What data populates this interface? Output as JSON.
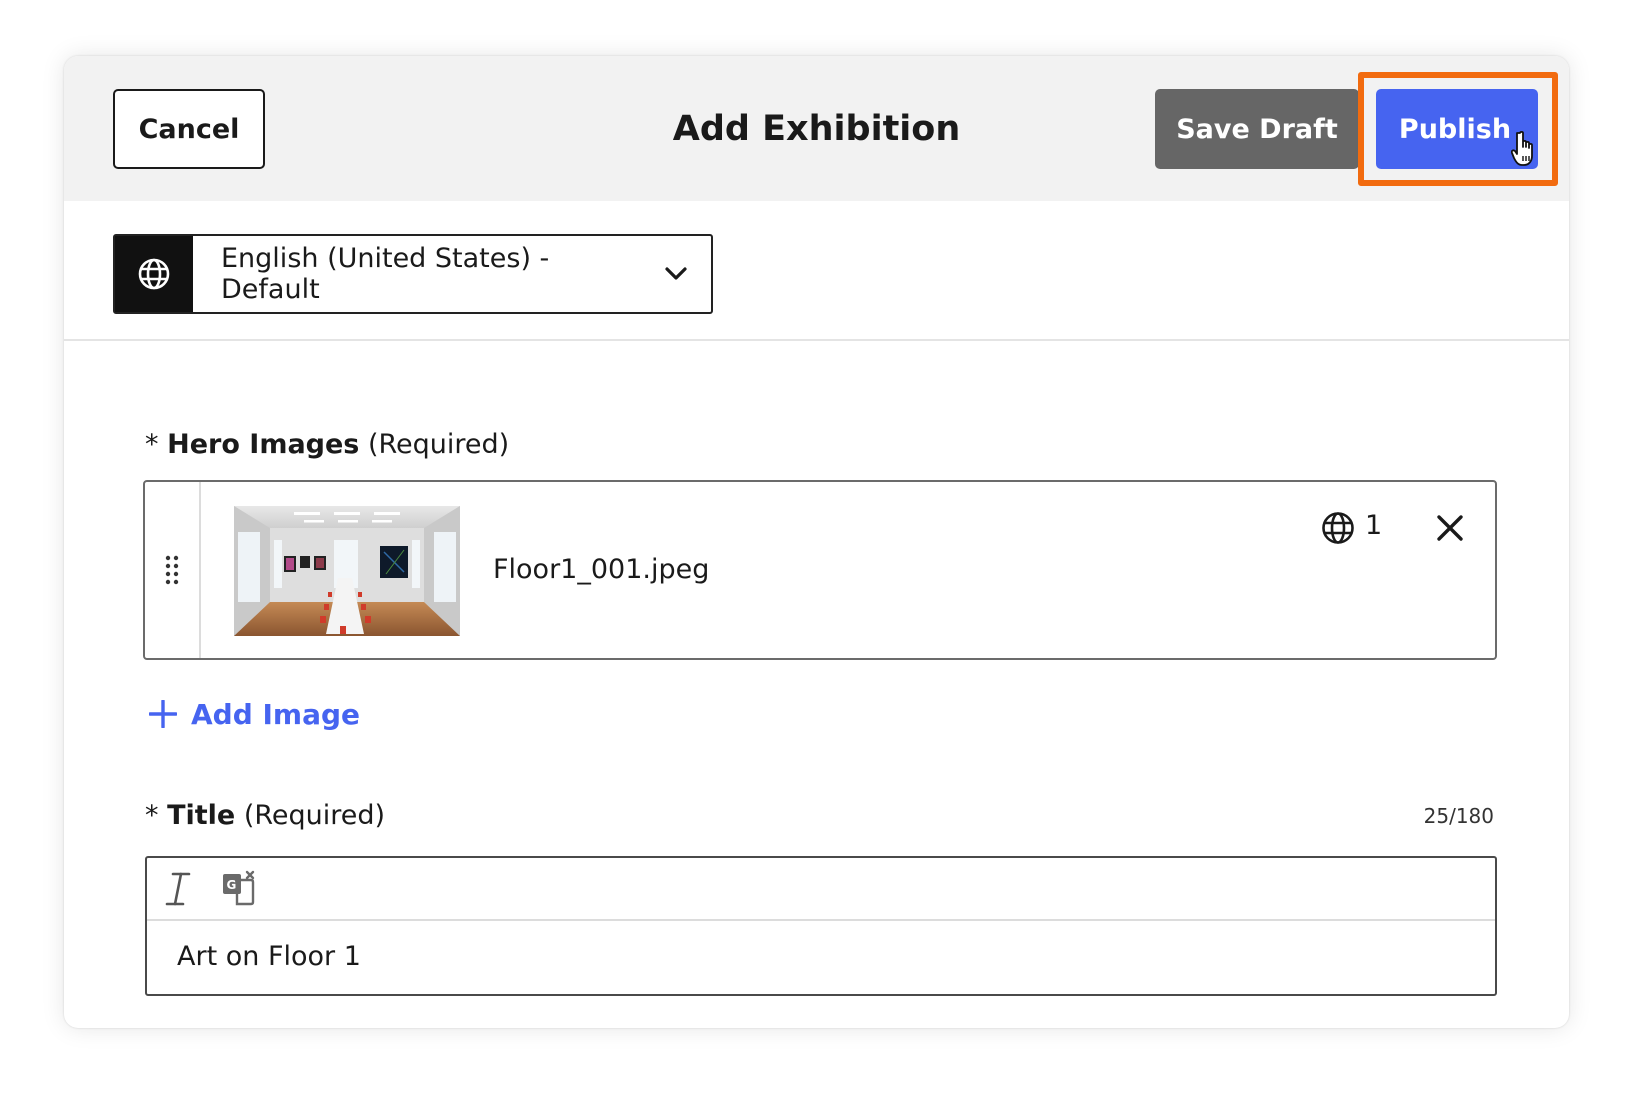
{
  "header": {
    "cancel_label": "Cancel",
    "title": "Add Exhibition",
    "save_draft_label": "Save Draft",
    "publish_label": "Publish"
  },
  "language": {
    "selected": "English (United States) - Default",
    "icon": "globe-icon",
    "dropdown_icon": "chevron-down-icon"
  },
  "hero_images": {
    "label_prefix": "* ",
    "label_bold": "Hero Images",
    "label_suffix": " (Required)",
    "items": [
      {
        "file_name": "Floor1_001.jpeg",
        "language_count": "1"
      }
    ],
    "add_label": "Add Image"
  },
  "title_field": {
    "label_prefix": "* ",
    "label_bold": "Title",
    "label_suffix": " (Required)",
    "char_count": "25/180",
    "value": "Art on Floor 1"
  },
  "colors": {
    "primary": "#4664f0",
    "secondary": "#666666",
    "highlight": "#f26b0f",
    "header_bg": "#f2f2f2"
  }
}
